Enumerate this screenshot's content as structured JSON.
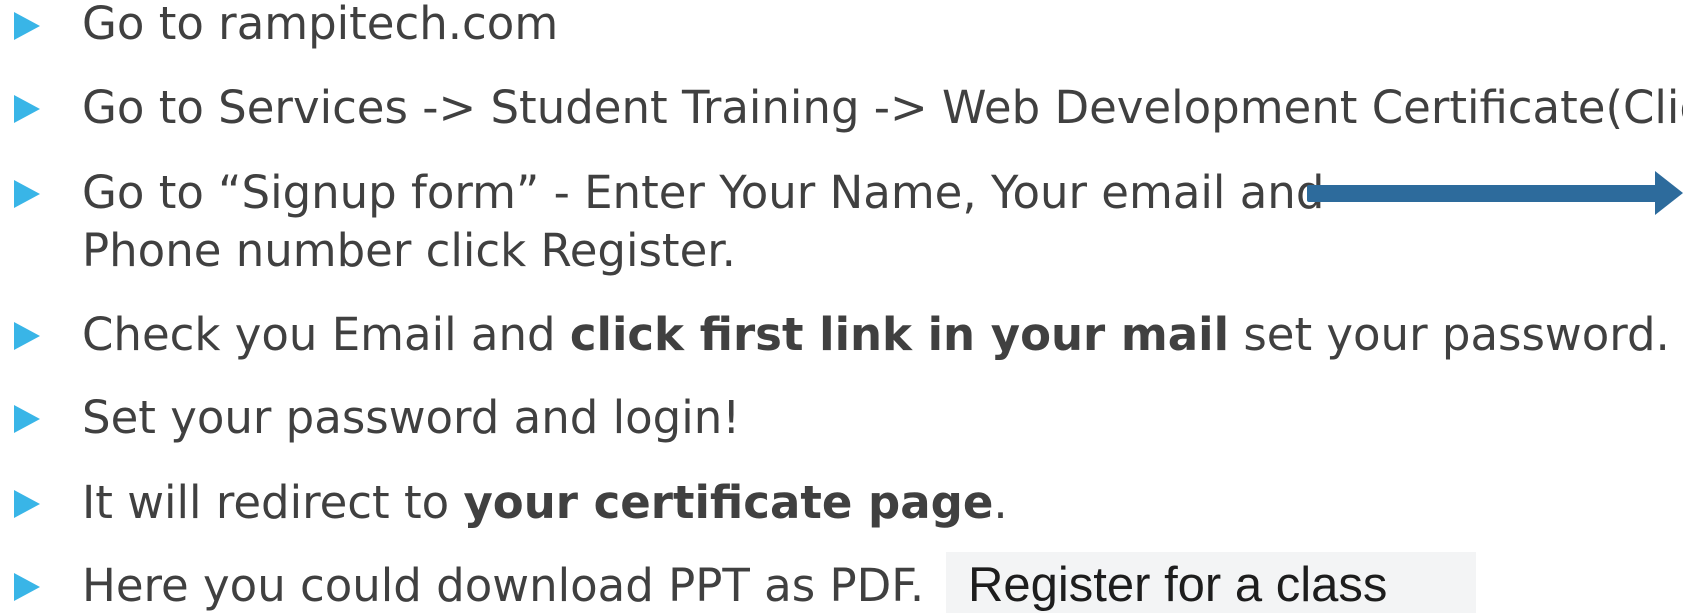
{
  "bullets": [
    {
      "text": "Go to rampitech.com"
    },
    {
      "text": "Go to Services -> Student Training -> Web Development Certificate(Click)"
    },
    {
      "line1": "Go to “Signup form” - Enter Your Name, Your email and",
      "line2": "Phone number click Register."
    },
    {
      "before": "Check you Email and ",
      "bold": "click first link in your mail",
      "after": " set your password."
    },
    {
      "text": "Set your password and login!"
    },
    {
      "before": "It will redirect to ",
      "bold": "your certificate page",
      "after": "."
    },
    {
      "text": "Here you could download PPT as PDF."
    }
  ],
  "register_snippet": {
    "label": "Register for a class"
  },
  "colors": {
    "bullet": "#39b5e7",
    "text": "#404040",
    "arrow": "#2d6b9c"
  },
  "icons": {
    "bullet": "triangle-bullet-icon",
    "arrow": "right-arrow-icon"
  }
}
